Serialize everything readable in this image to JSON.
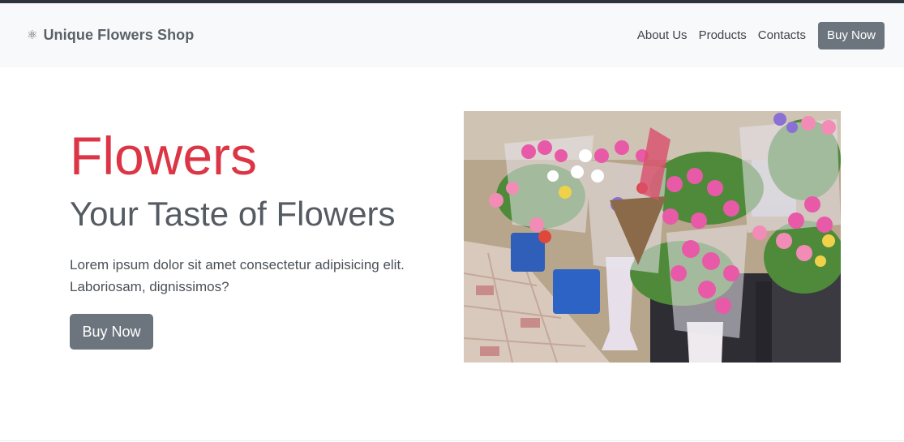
{
  "brand": {
    "icon": "atom-icon",
    "name": "Unique Flowers Shop"
  },
  "nav": {
    "links": [
      "About Us",
      "Products",
      "Contacts"
    ],
    "buy_label": "Buy Now"
  },
  "hero": {
    "title": "Flowers",
    "subtitle": "Your Taste of Flowers",
    "text": "Lorem ipsum dolor sit amet consectetur adipisicing elit. Laboriosam, dignissimos?",
    "button_label": "Buy Now",
    "image_alt": "tulip bouquets in buckets at a street market"
  },
  "colors": {
    "accent": "#dc3545",
    "button": "#6c757d",
    "navbar_bg": "#f8f9fa",
    "top_strip": "#2c343c"
  }
}
